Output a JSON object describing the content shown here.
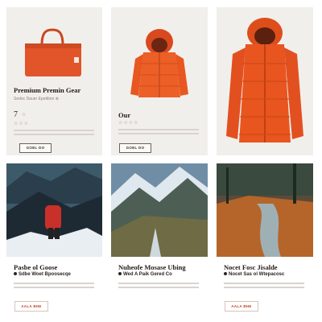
{
  "products": [
    {
      "title": "Premium Premin Gear",
      "meta": "Sedoc Dauer Epetibon ⊛",
      "rating_num": "7",
      "stars": "☆",
      "button": "GOEL DO",
      "image": "orange-duffel-bag",
      "accent": "#e2542a"
    },
    {
      "title": "Our",
      "stars": "☆☆☆☆",
      "button": "GOEL DO",
      "image": "orange-puffer-jacket",
      "accent": "#ec5f26"
    },
    {
      "image": "orange-hooded-down-jacket",
      "accent": "#e8551f"
    }
  ],
  "stories": [
    {
      "title": "Pasbe ol Goose",
      "subtitle": "Sdbe Woet Bpoosecqe",
      "button": "AALA BHE",
      "image": "mountain-hiker-red-backpack"
    },
    {
      "title": "Nuheofe Mosase Ubing",
      "subtitle": "Wed A Paik Gered Co",
      "button": "AALA BHE",
      "image": "snowy-mountain-valley"
    },
    {
      "title": "Nocet Fosc Jisalde",
      "subtitle": "Nocet Sas ol Wtepacosc",
      "button": "AALA BHE",
      "image": "autumn-forest-stream"
    }
  ]
}
